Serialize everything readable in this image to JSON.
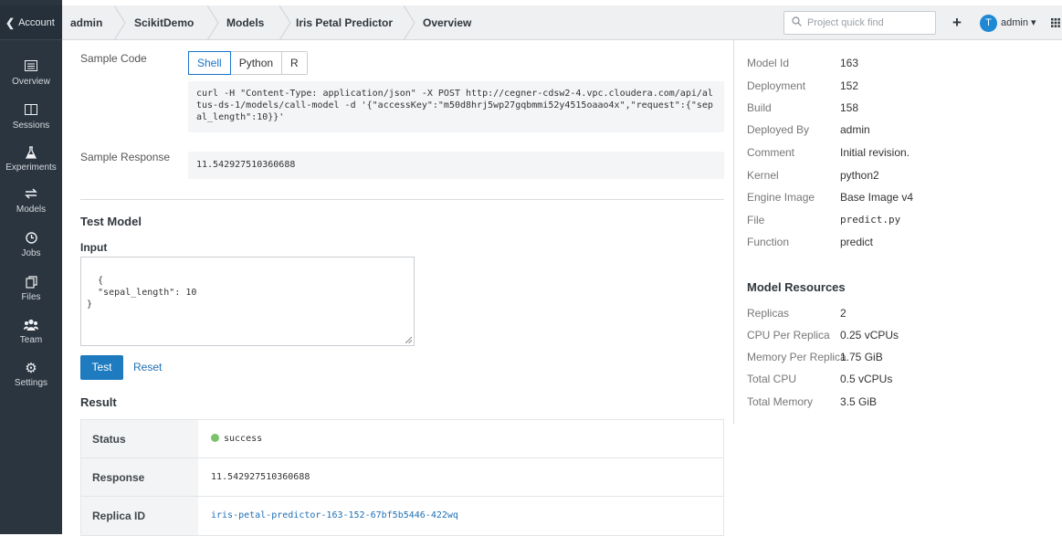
{
  "sidebar": {
    "account_label": "Account",
    "items": [
      {
        "label": "Overview",
        "icon": "overview-icon"
      },
      {
        "label": "Sessions",
        "icon": "sessions-icon"
      },
      {
        "label": "Experiments",
        "icon": "flask-icon"
      },
      {
        "label": "Models",
        "icon": "models-icon"
      },
      {
        "label": "Jobs",
        "icon": "clock-icon"
      },
      {
        "label": "Files",
        "icon": "files-icon"
      },
      {
        "label": "Team",
        "icon": "team-icon"
      },
      {
        "label": "Settings",
        "icon": "gear-icon"
      }
    ]
  },
  "breadcrumb": [
    "admin",
    "ScikitDemo",
    "Models",
    "Iris Petal Predictor",
    "Overview"
  ],
  "header": {
    "search_placeholder": "Project quick find",
    "avatar_initial": "T",
    "user_name": "admin"
  },
  "sample_code": {
    "label": "Sample Code",
    "tabs": [
      "Shell",
      "Python",
      "R"
    ],
    "active_tab": "Shell",
    "code": "curl -H \"Content-Type: application/json\" -X POST http://cegner-cdsw2-4.vpc.cloudera.com/api/altus-ds-1/models/call-model -d '{\"accessKey\":\"m50d8hrj5wp27gqbmmi52y4515oaao4x\",\"request\":{\"sepal_length\":10}}'"
  },
  "sample_response": {
    "label": "Sample Response",
    "value": "11.542927510360688"
  },
  "test_model": {
    "title": "Test Model",
    "input_label": "Input",
    "input_value": "{\n  \"sepal_length\": 10\n}",
    "test_button": "Test",
    "reset_button": "Reset"
  },
  "result": {
    "title": "Result",
    "rows": [
      {
        "key": "Status",
        "value": "success"
      },
      {
        "key": "Response",
        "value": "11.542927510360688"
      },
      {
        "key": "Replica ID",
        "value": "iris-petal-predictor-163-152-67bf5b5446-422wq"
      }
    ]
  },
  "model_details": [
    {
      "key": "Model Id",
      "value": "163"
    },
    {
      "key": "Deployment",
      "value": "152"
    },
    {
      "key": "Build",
      "value": "158"
    },
    {
      "key": "Deployed By",
      "value": "admin"
    },
    {
      "key": "Comment",
      "value": "Initial revision."
    },
    {
      "key": "Kernel",
      "value": "python2"
    },
    {
      "key": "Engine Image",
      "value": "Base Image v4"
    },
    {
      "key": "File",
      "value": "predict.py"
    },
    {
      "key": "Function",
      "value": "predict"
    }
  ],
  "model_resources": {
    "title": "Model Resources",
    "rows": [
      {
        "key": "Replicas",
        "value": "2"
      },
      {
        "key": "CPU Per Replica",
        "value": "0.25 vCPUs"
      },
      {
        "key": "Memory Per Replica",
        "value": "1.75 GiB"
      },
      {
        "key": "Total CPU",
        "value": "0.5 vCPUs"
      },
      {
        "key": "Total Memory",
        "value": "3.5 GiB"
      }
    ]
  },
  "colors": {
    "sidebar": "#2b3540",
    "accent": "#1e7bbf",
    "success": "#7ac36a"
  }
}
